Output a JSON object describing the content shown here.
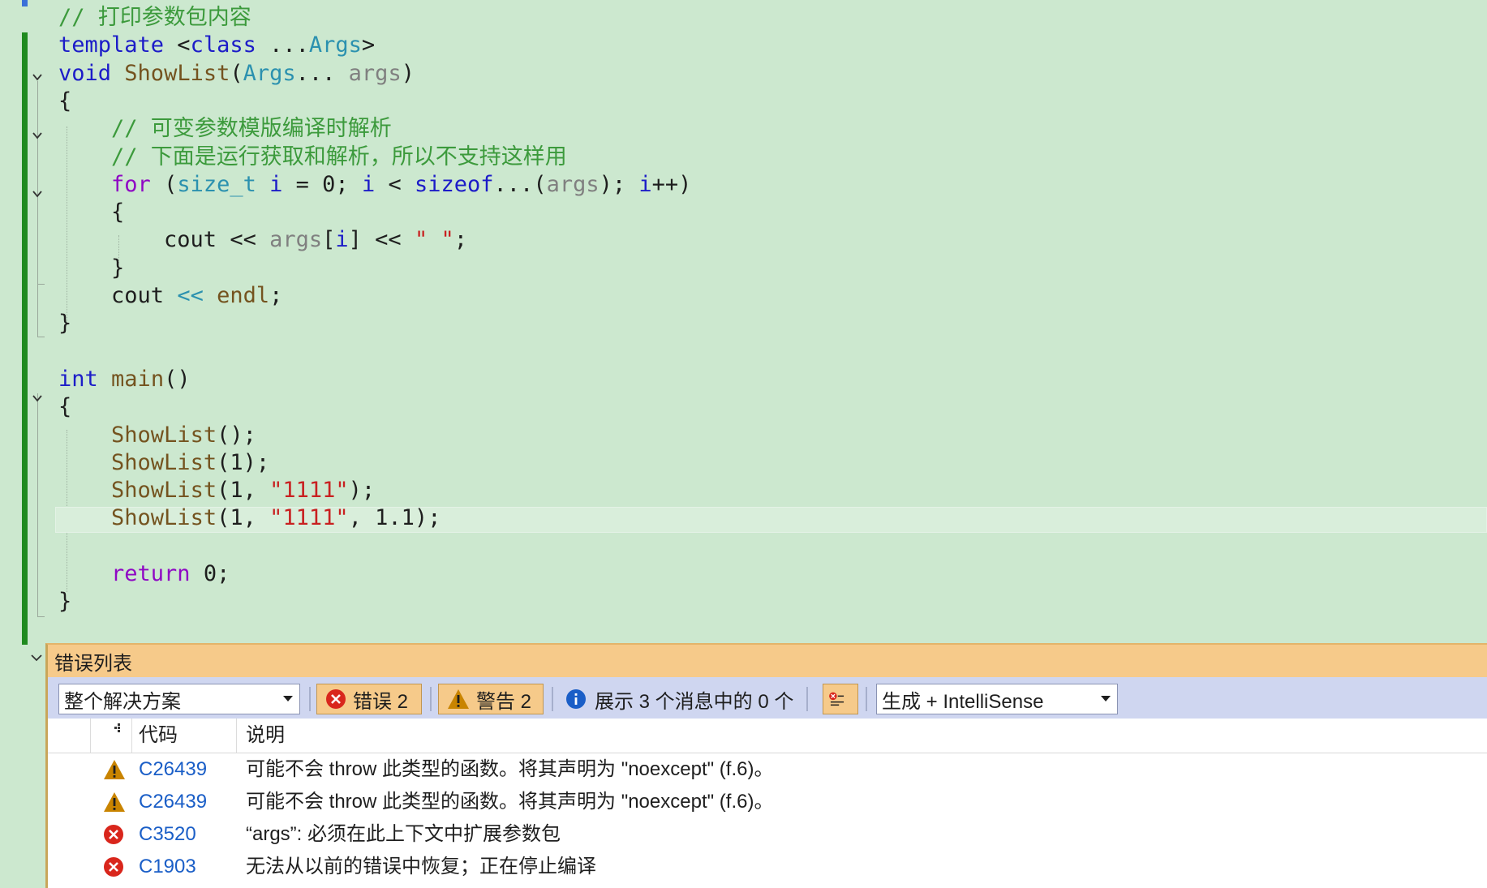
{
  "colors": {
    "editor_background": "#cce8cf",
    "comment": "#3c9a3c",
    "keyword": "#1c1cc8",
    "control_keyword": "#8f08c4",
    "type": "#2b91af",
    "function": "#74531f",
    "parameter": "#808080",
    "string": "#c82020",
    "change_bar": "#1f8a1f",
    "error_list_header": "#f6ca8a",
    "error_list_toolbar": "#cfd6f0",
    "error_code_link": "#1a5ec7"
  },
  "code_lines": [
    [
      {
        "t": "// 打印参数包内容",
        "c": "comment"
      }
    ],
    [
      {
        "t": "template",
        "c": "keyword"
      },
      {
        "t": " <",
        "c": "plain"
      },
      {
        "t": "class",
        "c": "keyword"
      },
      {
        "t": " ...",
        "c": "plain"
      },
      {
        "t": "Args",
        "c": "type"
      },
      {
        "t": ">",
        "c": "plain"
      }
    ],
    [
      {
        "t": "void",
        "c": "keyword"
      },
      {
        "t": " ",
        "c": "plain"
      },
      {
        "t": "ShowList",
        "c": "func"
      },
      {
        "t": "(",
        "c": "plain"
      },
      {
        "t": "Args",
        "c": "type"
      },
      {
        "t": "... ",
        "c": "plain"
      },
      {
        "t": "args",
        "c": "param"
      },
      {
        "t": ")",
        "c": "plain"
      }
    ],
    [
      {
        "t": "{",
        "c": "plain"
      }
    ],
    [
      {
        "t": "    // 可变参数模版编译时解析",
        "c": "comment"
      }
    ],
    [
      {
        "t": "    // 下面是运行获取和解析，所以不支持这样用",
        "c": "comment"
      }
    ],
    [
      {
        "t": "    ",
        "c": "plain"
      },
      {
        "t": "for",
        "c": "control"
      },
      {
        "t": " (",
        "c": "plain"
      },
      {
        "t": "size_t",
        "c": "type"
      },
      {
        "t": " ",
        "c": "plain"
      },
      {
        "t": "i",
        "c": "keyword"
      },
      {
        "t": " = 0; ",
        "c": "plain"
      },
      {
        "t": "i",
        "c": "keyword"
      },
      {
        "t": " < ",
        "c": "plain"
      },
      {
        "t": "sizeof",
        "c": "keyword"
      },
      {
        "t": "...(",
        "c": "plain"
      },
      {
        "t": "args",
        "c": "param"
      },
      {
        "t": "); ",
        "c": "plain"
      },
      {
        "t": "i",
        "c": "keyword"
      },
      {
        "t": "++)",
        "c": "plain"
      }
    ],
    [
      {
        "t": "    {",
        "c": "plain"
      }
    ],
    [
      {
        "t": "        cout << ",
        "c": "plain"
      },
      {
        "t": "args",
        "c": "param"
      },
      {
        "t": "[",
        "c": "plain"
      },
      {
        "t": "i",
        "c": "keyword"
      },
      {
        "t": "] << ",
        "c": "plain"
      },
      {
        "t": "\" \"",
        "c": "string"
      },
      {
        "t": ";",
        "c": "plain"
      }
    ],
    [
      {
        "t": "    }",
        "c": "plain"
      }
    ],
    [
      {
        "t": "    cout ",
        "c": "plain"
      },
      {
        "t": "<<",
        "c": "op2"
      },
      {
        "t": " ",
        "c": "plain"
      },
      {
        "t": "endl",
        "c": "func"
      },
      {
        "t": ";",
        "c": "plain"
      }
    ],
    [
      {
        "t": "}",
        "c": "plain"
      }
    ],
    [
      {
        "t": "",
        "c": "plain"
      }
    ],
    [
      {
        "t": "int",
        "c": "keyword"
      },
      {
        "t": " ",
        "c": "plain"
      },
      {
        "t": "main",
        "c": "func"
      },
      {
        "t": "()",
        "c": "plain"
      }
    ],
    [
      {
        "t": "{",
        "c": "plain"
      }
    ],
    [
      {
        "t": "    ",
        "c": "plain"
      },
      {
        "t": "ShowList",
        "c": "func"
      },
      {
        "t": "();",
        "c": "plain"
      }
    ],
    [
      {
        "t": "    ",
        "c": "plain"
      },
      {
        "t": "ShowList",
        "c": "func"
      },
      {
        "t": "(1);",
        "c": "plain"
      }
    ],
    [
      {
        "t": "    ",
        "c": "plain"
      },
      {
        "t": "ShowList",
        "c": "func"
      },
      {
        "t": "(1, ",
        "c": "plain"
      },
      {
        "t": "\"1111\"",
        "c": "string"
      },
      {
        "t": ");",
        "c": "plain"
      }
    ],
    [
      {
        "t": "    ",
        "c": "plain"
      },
      {
        "t": "ShowList",
        "c": "func"
      },
      {
        "t": "(1, ",
        "c": "plain"
      },
      {
        "t": "\"1111\"",
        "c": "string"
      },
      {
        "t": ", 1.1);",
        "c": "plain"
      }
    ],
    [
      {
        "t": "",
        "c": "plain"
      }
    ],
    [
      {
        "t": "    ",
        "c": "plain"
      },
      {
        "t": "return",
        "c": "control"
      },
      {
        "t": " 0;",
        "c": "plain"
      }
    ],
    [
      {
        "t": "}",
        "c": "plain"
      }
    ]
  ],
  "error_list": {
    "title": "错误列表",
    "scope": "整个解决方案",
    "errors_label": "错误 2",
    "warnings_label": "警告 2",
    "messages_label": "展示 3 个消息中的 0 个",
    "build_filter": "生成 + IntelliSense",
    "columns": {
      "code": "代码",
      "description": "说明"
    },
    "rows": [
      {
        "severity": "warning",
        "icon": "warning-icon",
        "code": "C26439",
        "description": "可能不会 throw 此类型的函数。将其声明为 \"noexcept\" (f.6)。"
      },
      {
        "severity": "warning",
        "icon": "warning-icon",
        "code": "C26439",
        "description": "可能不会 throw 此类型的函数。将其声明为 \"noexcept\" (f.6)。"
      },
      {
        "severity": "error",
        "icon": "error-icon",
        "code": "C3520",
        "description": "“args”: 必须在此上下文中扩展参数包"
      },
      {
        "severity": "error",
        "icon": "error-icon",
        "code": "C1903",
        "description": "无法从以前的错误中恢复；正在停止编译"
      }
    ]
  }
}
